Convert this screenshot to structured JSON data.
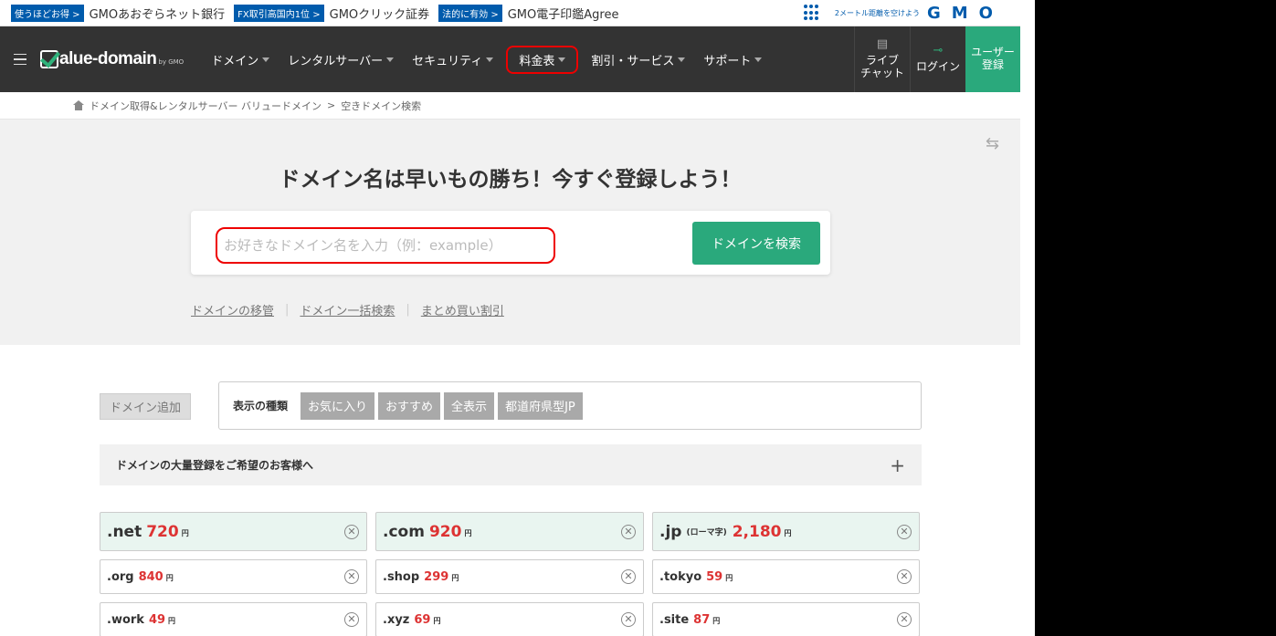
{
  "gmo_bar": {
    "links": [
      {
        "badge": "使うほどお得 >",
        "text": "GMOあおぞらネット銀行"
      },
      {
        "badge": "FX取引高国内1位 >",
        "text": "GMOクリック証券"
      },
      {
        "badge": "法的に有効 >",
        "text": "GMO電子印鑑Agree"
      }
    ],
    "catch": "2メートル距離を空けよう",
    "logo": "GMO"
  },
  "nav": {
    "logo": "alue-domain",
    "logo_by": "by GMO",
    "items": [
      "ドメイン",
      "レンタルサーバー",
      "セキュリティ",
      "料金表",
      "割引・サービス",
      "サポート"
    ],
    "live_chat_line1": "ライブ",
    "live_chat_line2": "チャット",
    "login": "ログイン",
    "register_line1": "ユーザー",
    "register_line2": "登録"
  },
  "breadcrumb": {
    "home": "ドメイン取得&レンタルサーバー バリュードメイン",
    "sep": ">",
    "current": "空きドメイン検索"
  },
  "hero": {
    "title": "ドメイン名は早いもの勝ち！今すぐ登録しよう！",
    "search_placeholder": "お好きなドメイン名を入力（例：example）",
    "search_button": "ドメインを検索",
    "links": [
      "ドメインの移管",
      "ドメイン一括検索",
      "まとめ買い割引"
    ]
  },
  "filter": {
    "add_domain": "ドメイン追加",
    "label": "表示の種類",
    "buttons": [
      "お気に入り",
      "おすすめ",
      "全表示",
      "都道府県型JP"
    ]
  },
  "bulk": {
    "text": "ドメインの大量登録をご希望のお客様へ",
    "plus": "+"
  },
  "yen": "円",
  "domains": [
    {
      "name": ".net",
      "note": "",
      "price": "720"
    },
    {
      "name": ".com",
      "note": "",
      "price": "920"
    },
    {
      "name": ".jp",
      "note": "(ローマ字)",
      "price": "2,180"
    },
    {
      "name": ".org",
      "note": "",
      "price": "840"
    },
    {
      "name": ".shop",
      "note": "",
      "price": "299"
    },
    {
      "name": ".tokyo",
      "note": "",
      "price": "59"
    },
    {
      "name": ".work",
      "note": "",
      "price": "49"
    },
    {
      "name": ".xyz",
      "note": "",
      "price": "69"
    },
    {
      "name": ".site",
      "note": "",
      "price": "87"
    }
  ]
}
